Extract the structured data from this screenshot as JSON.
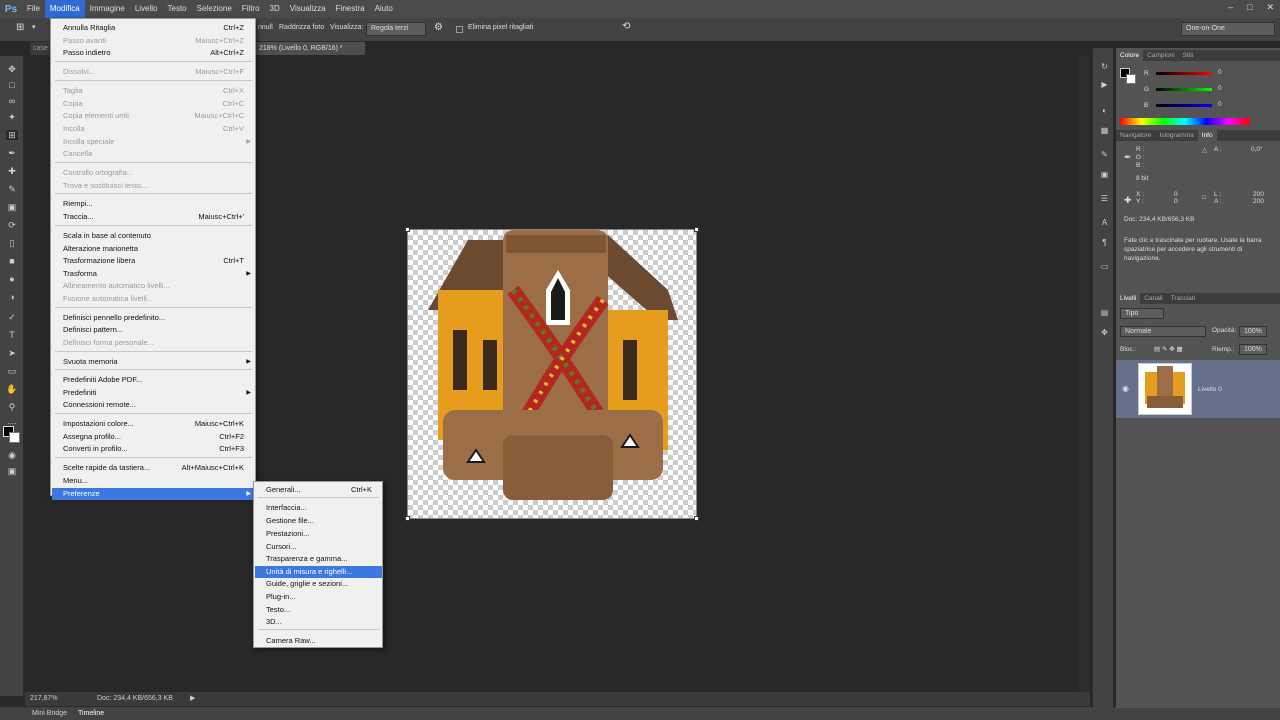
{
  "menubar": {
    "logo": "Ps",
    "items": [
      "File",
      "Modifica",
      "Immagine",
      "Livello",
      "Testo",
      "Selezione",
      "Filtro",
      "3D",
      "Visualizza",
      "Finestra",
      "Aiuto"
    ],
    "active": "Modifica"
  },
  "options": {
    "raddrizza": "Raddrizza foto",
    "visualizza": "Visualizza:",
    "regola": "Regola terzi",
    "elimina": "Elimina pixel ritagliati",
    "workspace": "One-on-One",
    "cancel_label": "nnull"
  },
  "document": {
    "tab": "218% (Livello 0, RGB/16) *",
    "tab_prev": "case"
  },
  "status": {
    "zoom": "217,87%",
    "doc": "Doc: 234,4 KB/656,3 KB"
  },
  "bottom": {
    "tab1": "Mini Bridge",
    "tab2": "Timeline"
  },
  "edit_menu": [
    {
      "label": "Annulla Ritaglia",
      "shortcut": "Ctrl+Z",
      "disabled": false
    },
    {
      "label": "Passo avanti",
      "shortcut": "Maiusc+Ctrl+Z",
      "disabled": true
    },
    {
      "label": "Passo indietro",
      "shortcut": "Alt+Ctrl+Z",
      "disabled": false
    },
    {
      "label": "Dissolvi...",
      "shortcut": "Maiusc+Ctrl+F",
      "disabled": true
    },
    {
      "label": "Taglia",
      "shortcut": "Ctrl+X",
      "disabled": true
    },
    {
      "label": "Copia",
      "shortcut": "Ctrl+C",
      "disabled": true
    },
    {
      "label": "Copia elementi uniti",
      "shortcut": "Maiusc+Ctrl+C",
      "disabled": true
    },
    {
      "label": "Incolla",
      "shortcut": "Ctrl+V",
      "disabled": true
    },
    {
      "label": "Incolla speciale",
      "shortcut": "",
      "disabled": true,
      "sub": true
    },
    {
      "label": "Cancella",
      "shortcut": "",
      "disabled": true
    },
    {
      "label": "Controllo ortografia...",
      "shortcut": "",
      "disabled": true
    },
    {
      "label": "Trova e sostituisci testo...",
      "shortcut": "",
      "disabled": true
    },
    {
      "label": "Riempi...",
      "shortcut": "",
      "disabled": false
    },
    {
      "label": "Traccia...",
      "shortcut": "Maiusc+Ctrl+'",
      "disabled": false
    },
    {
      "label": "Scala in base al contenuto",
      "shortcut": "",
      "disabled": false
    },
    {
      "label": "Alterazione marionetta",
      "shortcut": "",
      "disabled": false
    },
    {
      "label": "Trasformazione libera",
      "shortcut": "Ctrl+T",
      "disabled": false
    },
    {
      "label": "Trasforma",
      "shortcut": "",
      "disabled": false,
      "sub": true
    },
    {
      "label": "Allineamento automatico livelli...",
      "shortcut": "",
      "disabled": true
    },
    {
      "label": "Fusione automatica livelli...",
      "shortcut": "",
      "disabled": true
    },
    {
      "label": "Definisci pennello predefinito...",
      "shortcut": "",
      "disabled": false
    },
    {
      "label": "Definisci pattern...",
      "shortcut": "",
      "disabled": false
    },
    {
      "label": "Definisci forma personale...",
      "shortcut": "",
      "disabled": true
    },
    {
      "label": "Svuota memoria",
      "shortcut": "",
      "disabled": false,
      "sub": true
    },
    {
      "label": "Predefiniti Adobe PDF...",
      "shortcut": "",
      "disabled": false
    },
    {
      "label": "Predefiniti",
      "shortcut": "",
      "disabled": false,
      "sub": true
    },
    {
      "label": "Connessioni remote...",
      "shortcut": "",
      "disabled": false
    },
    {
      "label": "Impostazioni colore...",
      "shortcut": "Maiusc+Ctrl+K",
      "disabled": false
    },
    {
      "label": "Assegna profilo...",
      "shortcut": "Ctrl+F2",
      "disabled": false
    },
    {
      "label": "Converti in profilo...",
      "shortcut": "Ctrl+F3",
      "disabled": false
    },
    {
      "label": "Scelte rapide da tastiera...",
      "shortcut": "Alt+Maiusc+Ctrl+K",
      "disabled": false
    },
    {
      "label": "Menu...",
      "shortcut": "",
      "disabled": false
    },
    {
      "label": "Preferenze",
      "shortcut": "",
      "disabled": false,
      "sub": true,
      "highlight": true
    }
  ],
  "pref_menu": [
    {
      "label": "Generali...",
      "shortcut": "Ctrl+K"
    },
    {
      "label": "Interfaccia...",
      "shortcut": ""
    },
    {
      "label": "Gestione file...",
      "shortcut": ""
    },
    {
      "label": "Prestazioni...",
      "shortcut": ""
    },
    {
      "label": "Cursori...",
      "shortcut": ""
    },
    {
      "label": "Trasparenza e gamma...",
      "shortcut": ""
    },
    {
      "label": "Unità di misura e righelli...",
      "shortcut": "",
      "highlight": true
    },
    {
      "label": "Guide, griglie e sezioni...",
      "shortcut": ""
    },
    {
      "label": "Plug-in...",
      "shortcut": ""
    },
    {
      "label": "Testo...",
      "shortcut": ""
    },
    {
      "label": "3D...",
      "shortcut": ""
    },
    {
      "label": "Camera Raw...",
      "shortcut": ""
    }
  ],
  "panels": {
    "color_tabs": [
      "Colore",
      "Campioni",
      "Stili"
    ],
    "color": {
      "r": "0",
      "g": "0",
      "b": "0",
      "r_label": "R",
      "g_label": "G",
      "b_label": "B"
    },
    "info_tabs": [
      "Navigatore",
      "Istogramma",
      "Info"
    ],
    "info": {
      "r": "R :",
      "g": "G :",
      "b": "B :",
      "bit": "8 bit",
      "x": "X :",
      "y": "Y :",
      "x_val": "0",
      "y_val": "0",
      "a_label": "A :",
      "a_val": "0,0°",
      "l_label": "L :",
      "a2_label": "A :",
      "l_val": "200",
      "a2_val": "200",
      "doc": "Doc: 234,4 KB/656,3 KB",
      "hint": "Fate clic e trascinate per ruotare. Usate la barra spaziatrice per accedere agli strumenti di navigazione."
    },
    "layer_tabs": [
      "Livelli",
      "Canali",
      "Tracciati"
    ],
    "layers": {
      "kind": "Tipo",
      "blend": "Normale",
      "opacity_label": "Opacità:",
      "opacity": "100%",
      "lock_label": "Bloc.:",
      "fill_label": "Riemp.:",
      "fill": "100%",
      "layer_name": "Livello 0"
    }
  }
}
